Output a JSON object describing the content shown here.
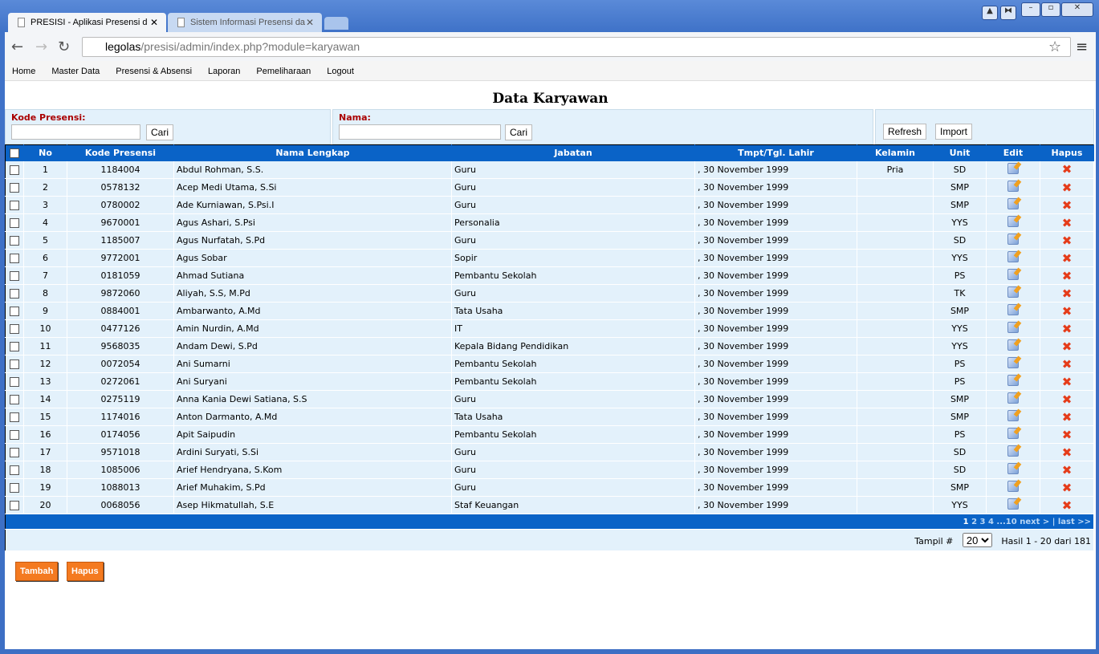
{
  "browser": {
    "tabs": [
      {
        "label": "PRESISI - Aplikasi Presensi d"
      },
      {
        "label": "Sistem Informasi Presensi da"
      }
    ],
    "url_host": "legolas",
    "url_path": "/presisi/admin/index.php?module=karyawan"
  },
  "menu": [
    "Home",
    "Master Data",
    "Presensi & Absensi",
    "Laporan",
    "Pemeliharaan",
    "Logout"
  ],
  "title": "Data Karyawan",
  "search": {
    "kode_label": "Kode Presensi:",
    "nama_label": "Nama:",
    "cari": "Cari",
    "refresh": "Refresh",
    "import": "Import"
  },
  "columns": [
    "No",
    "Kode Presensi",
    "Nama Lengkap",
    "Jabatan",
    "Tmpt/Tgl. Lahir",
    "Kelamin",
    "Unit",
    "Edit",
    "Hapus"
  ],
  "rows": [
    [
      "1",
      "1184004",
      "Abdul Rohman, S.S.",
      "Guru",
      ",  30 November 1999",
      "Pria",
      "SD"
    ],
    [
      "2",
      "0578132",
      "Acep Medi Utama, S.Si",
      "Guru",
      ",  30 November 1999",
      "",
      "SMP"
    ],
    [
      "3",
      "0780002",
      "Ade Kurniawan, S.Psi.I",
      "Guru",
      ",  30 November 1999",
      "",
      "SMP"
    ],
    [
      "4",
      "9670001",
      "Agus Ashari, S.Psi",
      "Personalia",
      ",  30 November 1999",
      "",
      "YYS"
    ],
    [
      "5",
      "1185007",
      "Agus Nurfatah, S.Pd",
      "Guru",
      ",  30 November 1999",
      "",
      "SD"
    ],
    [
      "6",
      "9772001",
      "Agus Sobar",
      "Sopir",
      ",  30 November 1999",
      "",
      "YYS"
    ],
    [
      "7",
      "0181059",
      "Ahmad Sutiana",
      "Pembantu Sekolah",
      ",  30 November 1999",
      "",
      "PS"
    ],
    [
      "8",
      "9872060",
      "Aliyah, S.S, M.Pd",
      "Guru",
      ",  30 November 1999",
      "",
      "TK"
    ],
    [
      "9",
      "0884001",
      "Ambarwanto, A.Md",
      "Tata Usaha",
      ",  30 November 1999",
      "",
      "SMP"
    ],
    [
      "10",
      "0477126",
      "Amin Nurdin, A.Md",
      "IT",
      ",  30 November 1999",
      "",
      "YYS"
    ],
    [
      "11",
      "9568035",
      "Andam Dewi, S.Pd",
      "Kepala Bidang Pendidikan",
      ",  30 November 1999",
      "",
      "YYS"
    ],
    [
      "12",
      "0072054",
      "Ani Sumarni",
      "Pembantu Sekolah",
      ",  30 November 1999",
      "",
      "PS"
    ],
    [
      "13",
      "0272061",
      "Ani Suryani",
      "Pembantu Sekolah",
      ",  30 November 1999",
      "",
      "PS"
    ],
    [
      "14",
      "0275119",
      "Anna Kania Dewi Satiana, S.S",
      "Guru",
      ",  30 November 1999",
      "",
      "SMP"
    ],
    [
      "15",
      "1174016",
      "Anton Darmanto, A.Md",
      "Tata Usaha",
      ",  30 November 1999",
      "",
      "SMP"
    ],
    [
      "16",
      "0174056",
      "Apit Saipudin",
      "Pembantu Sekolah",
      ",  30 November 1999",
      "",
      "PS"
    ],
    [
      "17",
      "9571018",
      "Ardini Suryati, S.Si",
      "Guru",
      ",  30 November 1999",
      "",
      "SD"
    ],
    [
      "18",
      "1085006",
      "Arief Hendryana, S.Kom",
      "Guru",
      ",  30 November 1999",
      "",
      "SD"
    ],
    [
      "19",
      "1088013",
      "Arief Muhakim, S.Pd",
      "Guru",
      ",  30 November 1999",
      "",
      "SMP"
    ],
    [
      "20",
      "0068056",
      "Asep Hikmatullah, S.E",
      "Staf Keuangan",
      ",  30 November 1999",
      "",
      "YYS"
    ]
  ],
  "pagination": {
    "current": "1",
    "pages": "2 3 4 ...10",
    "next": "next >",
    "sep": " | ",
    "last": "last >>"
  },
  "footer": {
    "tampil_label": "Tampil #",
    "per_page": "20",
    "hasil": "Hasil 1 - 20 dari 181"
  },
  "actions": {
    "tambah": "Tambah",
    "hapus": "Hapus"
  }
}
